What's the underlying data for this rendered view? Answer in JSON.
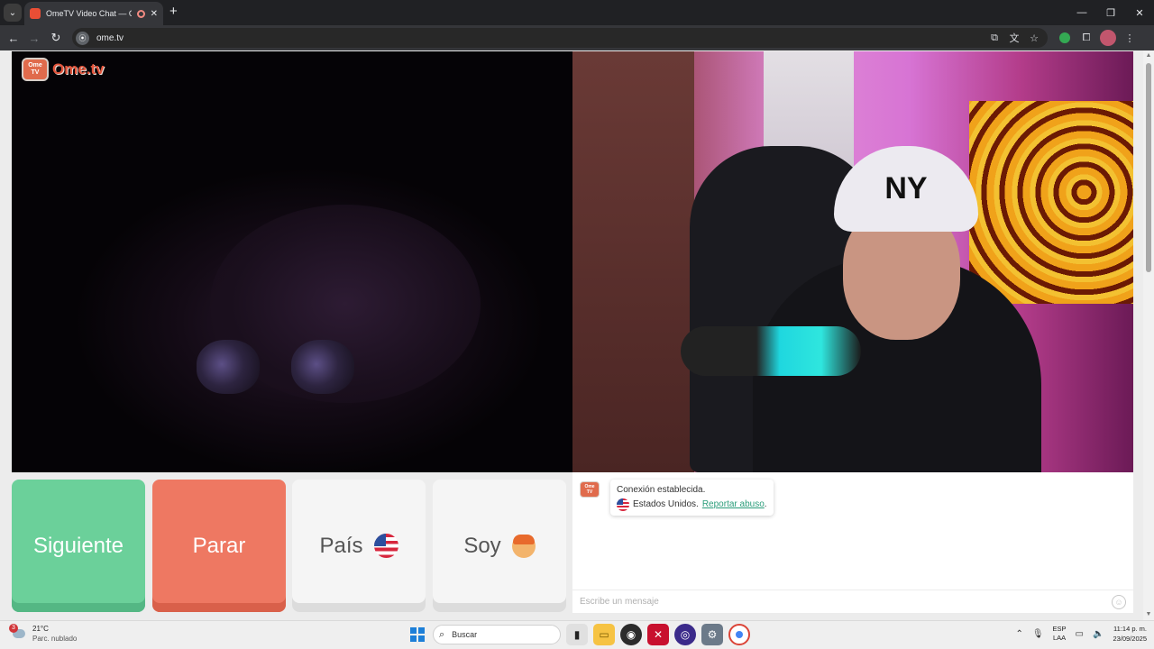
{
  "browser": {
    "tab_title": "OmeTV Video Chat — Ome",
    "url": "ome.tv",
    "tab_close": "✕",
    "new_tab": "+"
  },
  "site": {
    "logo_tv_line1": "Ome",
    "logo_tv_line2": "TV",
    "logo_text": "Ome.tv",
    "cap_text": "NY"
  },
  "controls": {
    "next_label": "Siguiente",
    "stop_label": "Parar",
    "country_label": "País",
    "gender_label": "Soy"
  },
  "chat": {
    "status_text": "Conexión establecida.",
    "country_text": "Estados Unidos.",
    "report_link": "Reportar abuso",
    "report_suffix": ".",
    "placeholder": "Escribe un mensaje"
  },
  "taskbar": {
    "weather_badge": "3",
    "temperature": "21°C",
    "weather_desc": "Parc. nublado",
    "search_label": "Buscar",
    "lang_line1": "ESP",
    "lang_line2": "LAA",
    "time": "11:14 p. m.",
    "date": "23/09/2025"
  },
  "colors": {
    "next_button": "#6bd09a",
    "stop_button": "#ee7862",
    "report_link": "#2a9d7a",
    "brand": "#e2543b"
  }
}
